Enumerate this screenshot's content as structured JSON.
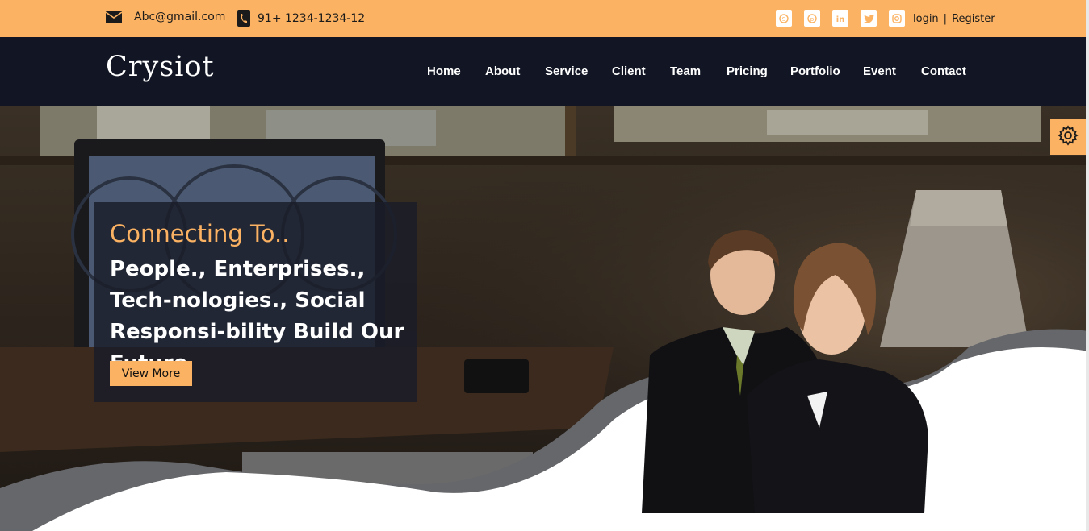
{
  "topbar": {
    "email": "Abc@gmail.com",
    "phone": "91+ 1234-1234-12",
    "email_icon": "envelope-icon",
    "phone_icon": "phone-icon",
    "socials": [
      "skype-icon",
      "pinterest-icon",
      "linkedin-icon",
      "twitter-icon",
      "instagram-icon"
    ],
    "login": "login",
    "separator": "|",
    "register": "Register"
  },
  "navbar": {
    "logo": "Crysiot",
    "items": [
      "Home",
      "About",
      "Service",
      "Client",
      "Team",
      "Pricing",
      "Portfolio",
      "Event",
      "Contact"
    ]
  },
  "hero": {
    "title": "Connecting To..",
    "body": "People., Enterprises., Tech-nologies., Social Responsi-bility Build Our Future",
    "button": "View More",
    "settings_icon": "gear-icon"
  },
  "colors": {
    "accent": "#fbb262",
    "navbar_bg": "#121624",
    "overlay_bg": "#1a1c28"
  }
}
